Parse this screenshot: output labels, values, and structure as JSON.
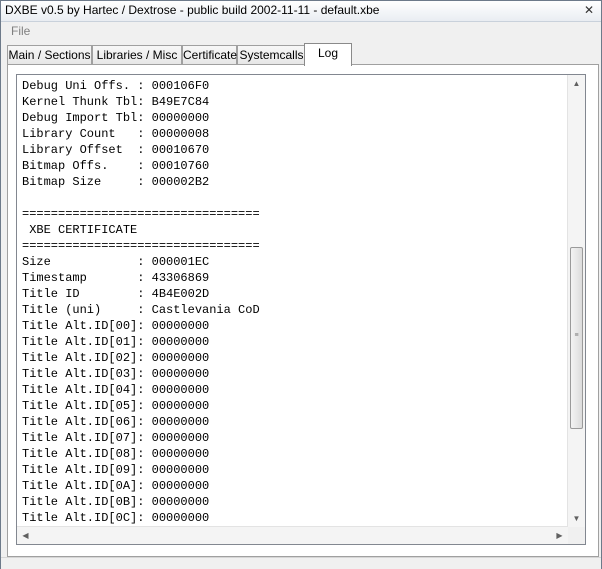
{
  "window": {
    "title": "DXBE v0.5 by Hartec / Dextrose - public build 2002-11-11 - default.xbe"
  },
  "menu": {
    "file_label": "File"
  },
  "tabs": [
    {
      "label": "Main / Sections"
    },
    {
      "label": "Libraries / Misc"
    },
    {
      "label": "Certificate"
    },
    {
      "label": "Systemcalls"
    },
    {
      "label": "Log"
    }
  ],
  "log": {
    "lines": [
      "Debug Uni Offs. : 000106F0",
      "Kernel Thunk Tbl: B49E7C84",
      "Debug Import Tbl: 00000000",
      "Library Count   : 00000008",
      "Library Offset  : 00010670",
      "Bitmap Offs.    : 00010760",
      "Bitmap Size     : 000002B2",
      "",
      "=================================",
      " XBE CERTIFICATE",
      "=================================",
      "Size            : 000001EC",
      "Timestamp       : 43306869",
      "Title ID        : 4B4E002D",
      "Title (uni)     : Castlevania CoD",
      "Title Alt.ID[00]: 00000000",
      "Title Alt.ID[01]: 00000000",
      "Title Alt.ID[02]: 00000000",
      "Title Alt.ID[03]: 00000000",
      "Title Alt.ID[04]: 00000000",
      "Title Alt.ID[05]: 00000000",
      "Title Alt.ID[06]: 00000000",
      "Title Alt.ID[07]: 00000000",
      "Title Alt.ID[08]: 00000000",
      "Title Alt.ID[09]: 00000000",
      "Title Alt.ID[0A]: 00000000",
      "Title Alt.ID[0B]: 00000000",
      "Title Alt.ID[0C]: 00000000"
    ]
  },
  "icons": {
    "close": "close-icon",
    "scroll_up": "arrow-up-icon",
    "scroll_down": "arrow-down-icon",
    "scroll_left": "arrow-left-icon",
    "scroll_right": "arrow-right-icon"
  }
}
